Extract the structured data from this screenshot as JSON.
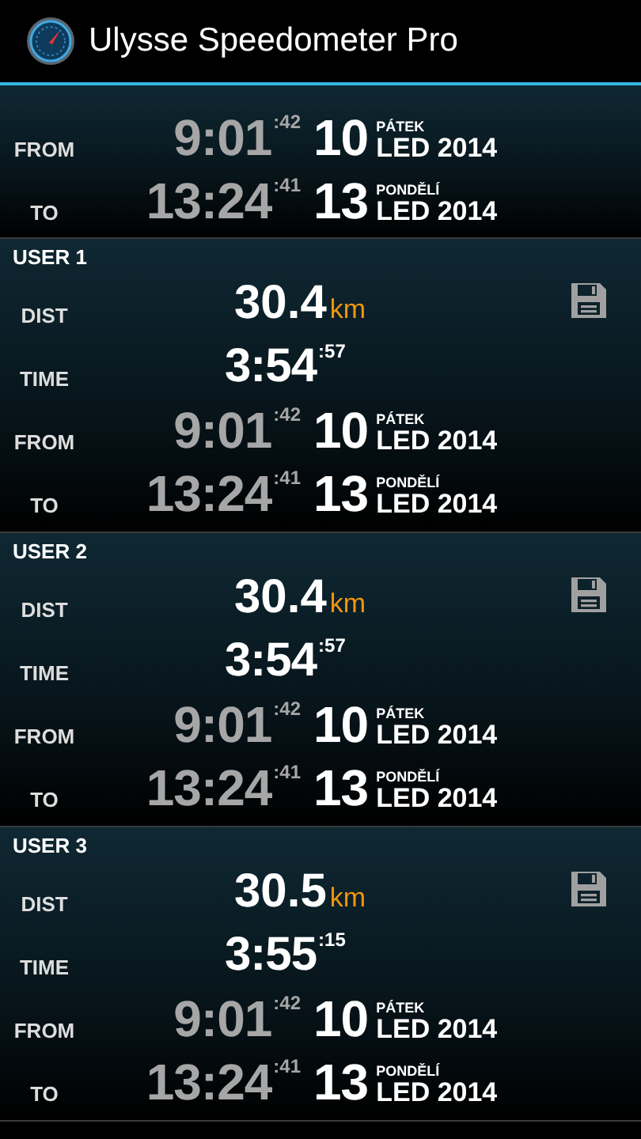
{
  "app_bar": {
    "title": "Ulysse Speedometer Pro"
  },
  "sections": [
    {
      "kind": "summary",
      "rows": [
        {
          "kind": "timestamp",
          "label": "FROM",
          "time": "9:01",
          "seconds": ":42",
          "day": "10",
          "weekday": "PÁTEK",
          "month_year": "LED 2014"
        },
        {
          "kind": "timestamp",
          "label": "TO",
          "time": "13:24",
          "seconds": ":41",
          "day": "13",
          "weekday": "PONDĚLÍ",
          "month_year": "LED 2014"
        }
      ]
    },
    {
      "kind": "user",
      "title": "USER 1",
      "rows": [
        {
          "kind": "distance",
          "label": "DIST",
          "value": "30.4",
          "unit": "km"
        },
        {
          "kind": "duration",
          "label": "TIME",
          "time": "3:54",
          "seconds": ":57"
        },
        {
          "kind": "timestamp",
          "label": "FROM",
          "time": "9:01",
          "seconds": ":42",
          "day": "10",
          "weekday": "PÁTEK",
          "month_year": "LED 2014"
        },
        {
          "kind": "timestamp",
          "label": "TO",
          "time": "13:24",
          "seconds": ":41",
          "day": "13",
          "weekday": "PONDĚLÍ",
          "month_year": "LED 2014"
        }
      ]
    },
    {
      "kind": "user",
      "title": "USER 2",
      "rows": [
        {
          "kind": "distance",
          "label": "DIST",
          "value": "30.4",
          "unit": "km"
        },
        {
          "kind": "duration",
          "label": "TIME",
          "time": "3:54",
          "seconds": ":57"
        },
        {
          "kind": "timestamp",
          "label": "FROM",
          "time": "9:01",
          "seconds": ":42",
          "day": "10",
          "weekday": "PÁTEK",
          "month_year": "LED 2014"
        },
        {
          "kind": "timestamp",
          "label": "TO",
          "time": "13:24",
          "seconds": ":41",
          "day": "13",
          "weekday": "PONDĚLÍ",
          "month_year": "LED 2014"
        }
      ]
    },
    {
      "kind": "user",
      "title": "USER 3",
      "rows": [
        {
          "kind": "distance",
          "label": "DIST",
          "value": "30.5",
          "unit": "km"
        },
        {
          "kind": "duration",
          "label": "TIME",
          "time": "3:55",
          "seconds": ":15"
        },
        {
          "kind": "timestamp",
          "label": "FROM",
          "time": "9:01",
          "seconds": ":42",
          "day": "10",
          "weekday": "PÁTEK",
          "month_year": "LED 2014"
        },
        {
          "kind": "timestamp",
          "label": "TO",
          "time": "13:24",
          "seconds": ":41",
          "day": "13",
          "weekday": "PONDĚLÍ",
          "month_year": "LED 2014"
        }
      ]
    }
  ]
}
